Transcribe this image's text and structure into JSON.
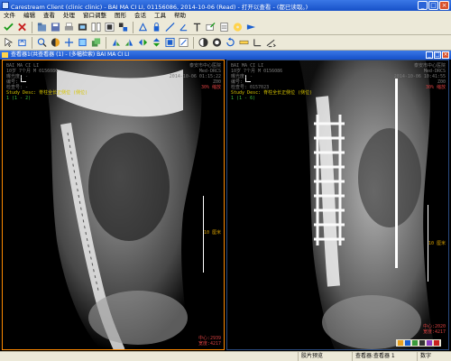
{
  "window": {
    "title": "Carestream Client (clinic clinic) - BAI MA CI LI, 01156086, 2014-10-06 (Read) - 打开以查看 - (都已读取。)",
    "buttons": {
      "minimize": "_",
      "maximize": "□",
      "close": "×"
    }
  },
  "menu": [
    "文件",
    "编辑",
    "查看",
    "处理",
    "窗口调整",
    "图形",
    "会话",
    "工具",
    "帮助"
  ],
  "viewer_header": {
    "title": "查看器1(共查看器 (1) - (多幅检索)  BAI MA CI LI"
  },
  "left_pane": {
    "top_left": {
      "name": "BAI MA CI LI",
      "lines": [
        "10岁 7个月 M 0156086",
        "曝光度: -",
        "编号: -",
        "检查号: -"
      ],
      "study": "Study Desc: 脊柱全长正侧位 (侧位)",
      "selection": "1 (1 - 2)"
    },
    "top_right": {
      "lines": [
        "泰安市中心医院",
        "Med-DRCS",
        "2014-10-06 01:15:22",
        "Z00",
        "30% 缩放"
      ]
    },
    "mid_right": {
      "label": "10 厘米"
    },
    "bottom_right": {
      "lines": [
        "中心:2939",
        "宽度:4217"
      ]
    }
  },
  "right_pane": {
    "top_left": {
      "name": "BAI MA CI LI",
      "lines": [
        "10岁 7个月 M 0156086",
        "曝光度: -",
        "编号: -",
        "检查号: 0157023"
      ],
      "study": "Study Desc: 脊柱全长正侧位 (侧位)",
      "selection": "1 (1 - 6)"
    },
    "top_right": {
      "lines": [
        "泰安市中心医院",
        "Med-DRCS",
        "2014-10-06 10:41:55",
        "Z00",
        "30% 缩放"
      ]
    },
    "mid_right": {
      "label": "10 厘米"
    },
    "bottom_right": {
      "lines": [
        "中心:2020",
        "宽度:4217"
      ]
    }
  },
  "status": {
    "help": "",
    "cell1": "胶片预览",
    "cell2": "查看器:查看器 1",
    "cell3": "数字"
  },
  "colors": {
    "active_border": "#ff8a00",
    "overlay_green": "#3fbf3f",
    "overlay_yellow": "#d7c400",
    "overlay_red": "#d84040"
  }
}
